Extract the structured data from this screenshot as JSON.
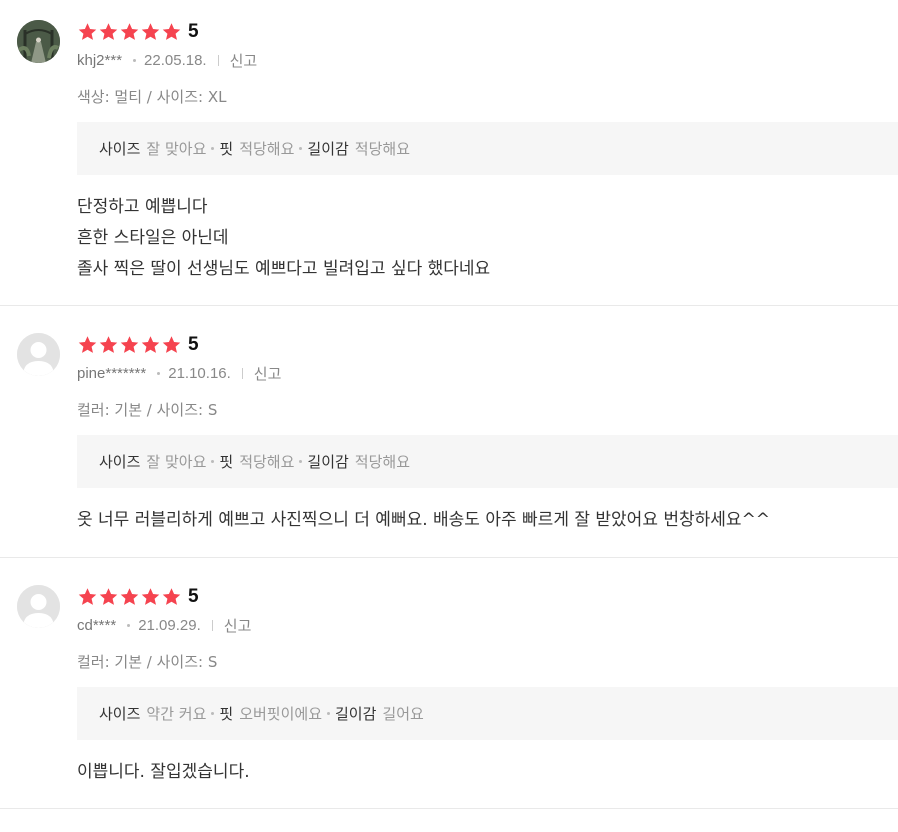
{
  "star_color": "#f5434f",
  "reviews": [
    {
      "score": "5",
      "user": "khj2***",
      "date": "22.05.18.",
      "report": "신고",
      "option": "색상: 멀티 / 사이즈: XL",
      "fit": {
        "size_label": "사이즈",
        "size_value": "잘 맞아요",
        "fit_label": "핏",
        "fit_value": "적당해요",
        "length_label": "길이감",
        "length_value": "적당해요"
      },
      "text": [
        "단정하고 예쁩니다",
        "흔한 스타일은 아닌데",
        "졸사 찍은 딸이 선생님도 예쁘다고 빌려입고 싶다 했다네요"
      ]
    },
    {
      "score": "5",
      "user": "pine*******",
      "date": "21.10.16.",
      "report": "신고",
      "option": "컬러: 기본 / 사이즈: S",
      "fit": {
        "size_label": "사이즈",
        "size_value": "잘 맞아요",
        "fit_label": "핏",
        "fit_value": "적당해요",
        "length_label": "길이감",
        "length_value": "적당해요"
      },
      "text": [
        "옷 너무 러블리하게 예쁘고 사진찍으니 더 예뻐요. 배송도 아주 빠르게 잘 받았어요 번창하세요^^"
      ]
    },
    {
      "score": "5",
      "user": "cd****",
      "date": "21.09.29.",
      "report": "신고",
      "option": "컬러: 기본 / 사이즈: S",
      "fit": {
        "size_label": "사이즈",
        "size_value": "약간 커요",
        "fit_label": "핏",
        "fit_value": "오버핏이에요",
        "length_label": "길이감",
        "length_value": "길어요"
      },
      "text": [
        "이쁩니다. 잘입겠습니다."
      ]
    }
  ]
}
